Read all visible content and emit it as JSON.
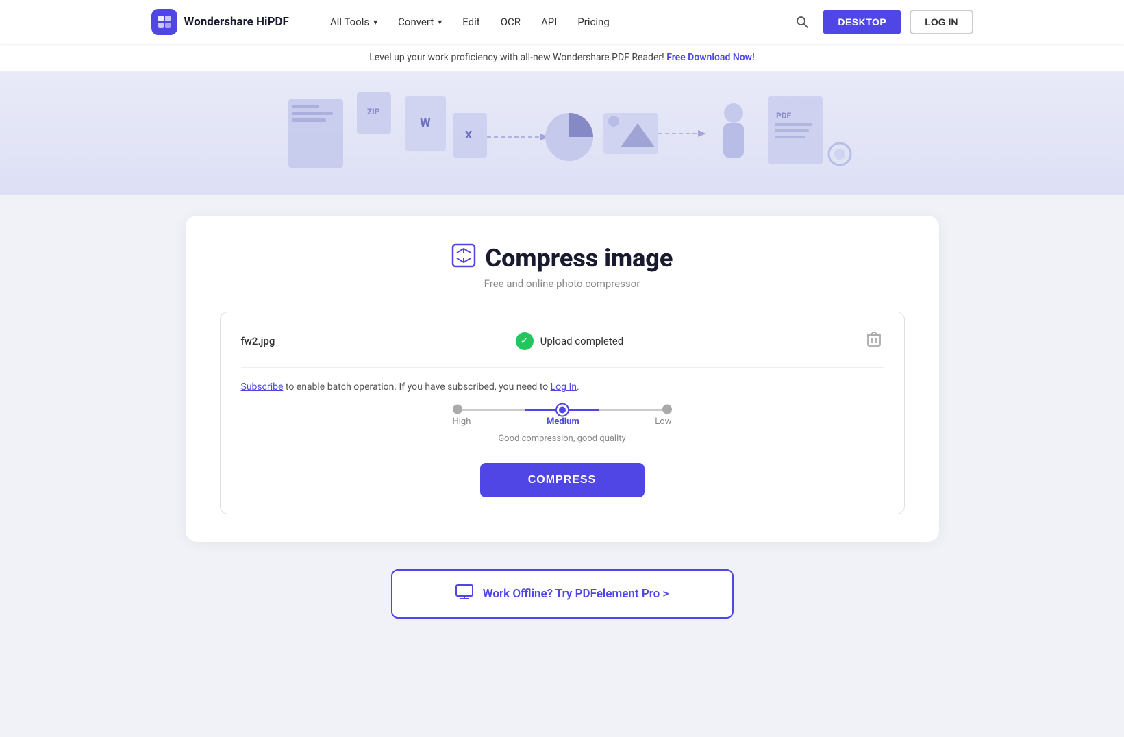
{
  "nav": {
    "logo_text": "Wondershare HiPDF",
    "links": [
      {
        "label": "All Tools",
        "has_dropdown": true
      },
      {
        "label": "Convert",
        "has_dropdown": true
      },
      {
        "label": "Edit",
        "has_dropdown": false
      },
      {
        "label": "OCR",
        "has_dropdown": false
      },
      {
        "label": "API",
        "has_dropdown": false
      },
      {
        "label": "Pricing",
        "has_dropdown": false
      }
    ],
    "desktop_btn": "DESKTOP",
    "login_btn": "LOG IN"
  },
  "banner": {
    "text": "Level up your work proficiency with all-new Wondershare PDF Reader!",
    "link_text": "Free Download Now!"
  },
  "tool": {
    "title": "Compress image",
    "subtitle": "Free and online photo compressor",
    "file_name": "fw2.jpg",
    "upload_status": "Upload completed",
    "subscribe_text": "to enable batch operation. If you have subscribed, you need to",
    "subscribe_link": "Subscribe",
    "login_link": "Log In",
    "quality_options": [
      {
        "label": "High",
        "active": false
      },
      {
        "label": "Medium",
        "active": true
      },
      {
        "label": "Low",
        "active": false
      }
    ],
    "quality_desc": "Good compression, good quality",
    "compress_btn": "COMPRESS"
  },
  "offline_cta": {
    "text": "Work Offline? Try PDFelement Pro >"
  }
}
